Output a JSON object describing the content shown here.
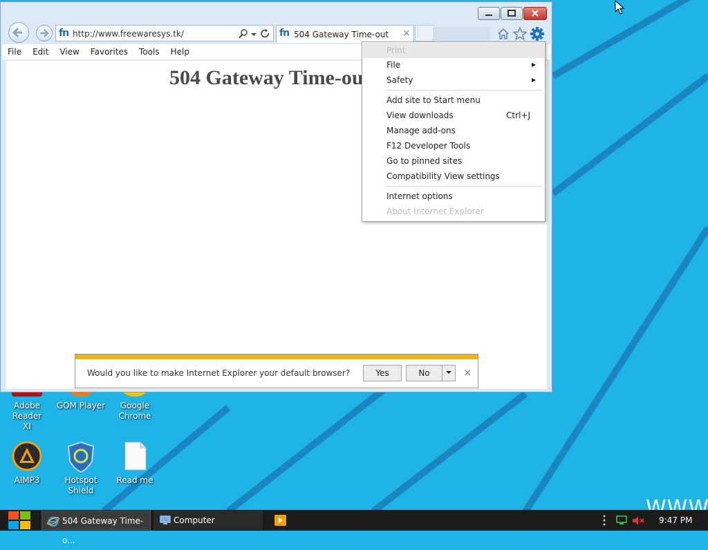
{
  "colors": {
    "desktop_bg": "#1fb4e8",
    "notify_bar": "#f5b400",
    "taskbar": "#1c1c1c"
  },
  "desktop": {
    "icons": [
      {
        "label_line1": "Adobe Reader",
        "label_line2": "XI",
        "icon": "adobe-reader-icon"
      },
      {
        "label_line1": "GOM Player",
        "label_line2": "",
        "icon": "gom-player-icon"
      },
      {
        "label_line1": "Google",
        "label_line2": "Chrome",
        "icon": "chrome-icon"
      },
      {
        "label_line1": "AIMP3",
        "label_line2": "",
        "icon": "aimp3-icon"
      },
      {
        "label_line1": "Hotspot",
        "label_line2": "Shield",
        "icon": "hotspot-shield-icon"
      },
      {
        "label_line1": "Read me",
        "label_line2": "",
        "icon": "text-file-icon"
      }
    ],
    "watermark": "WWW.FR"
  },
  "browser": {
    "address_url": "http://www.freewaresys.tk/",
    "tab_title": "504 Gateway Time-out",
    "tab_close": "×",
    "logo_text": "fn",
    "menubar": [
      "File",
      "Edit",
      "View",
      "Favorites",
      "Tools",
      "Help"
    ],
    "page_heading": "504 Gateway Time-out"
  },
  "tools_menu": {
    "items": [
      {
        "label": "Print",
        "disabled": true
      },
      {
        "label": "File",
        "submenu": true
      },
      {
        "label": "Safety",
        "submenu": true
      },
      {
        "label": "Add site to Start menu"
      },
      {
        "label": "View downloads",
        "shortcut": "Ctrl+J"
      },
      {
        "label": "Manage add-ons"
      },
      {
        "label": "F12 Developer Tools"
      },
      {
        "label": "Go to pinned sites"
      },
      {
        "label": "Compatibility View settings"
      },
      {
        "label": "Internet options"
      },
      {
        "label": "About Internet Explorer",
        "disabled": true
      }
    ]
  },
  "notification": {
    "message": "Would you like to make Internet Explorer your default browser?",
    "yes_label": "Yes",
    "no_label": "No",
    "close": "×"
  },
  "taskbar": {
    "items": [
      {
        "label": "504 Gateway Time-o...",
        "icon": "ie-icon"
      },
      {
        "label": "Computer",
        "icon": "computer-icon"
      }
    ],
    "clock": "9:47 PM"
  }
}
